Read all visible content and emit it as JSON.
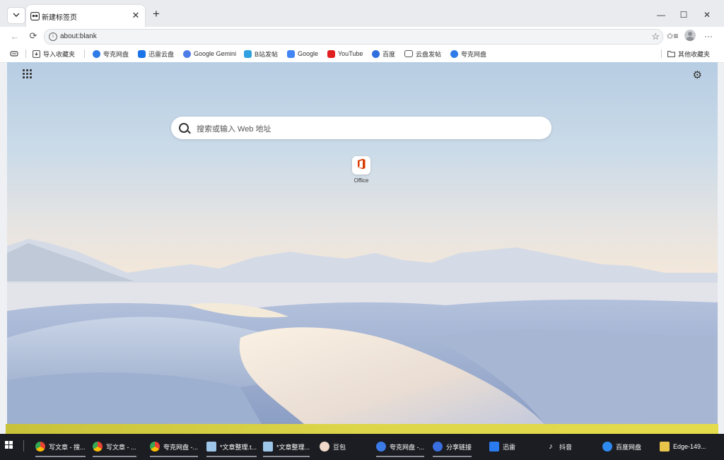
{
  "browser": {
    "tab": {
      "title": "新建标签页",
      "close_glyph": "✕"
    },
    "new_tab_glyph": "+",
    "window": {
      "minimize": "—",
      "maximize": "☐",
      "close": "✕"
    },
    "address": {
      "value": "about:blank",
      "info_glyph": "i",
      "star_glyph": "☆"
    },
    "nav": {
      "back": "←",
      "refresh": "⟳",
      "favorites": "✩≡",
      "more": "···"
    }
  },
  "bookmarks": {
    "import": "导入收藏夹",
    "items": [
      {
        "label": "夸克网盘",
        "icon": "cloud-icon",
        "color": "#2f7be8"
      },
      {
        "label": "迅雷云盘",
        "icon": "xunlei-icon",
        "color": "#1a73e8"
      },
      {
        "label": "Google Gemini",
        "icon": "gemini-icon",
        "color": "#4f7de8"
      },
      {
        "label": "B站发帖",
        "icon": "bilibili-icon",
        "color": "#2fa0e0"
      },
      {
        "label": "Google",
        "icon": "google-icon",
        "color": "#4285f4"
      },
      {
        "label": "YouTube",
        "icon": "youtube-icon",
        "color": "#e02020"
      },
      {
        "label": "百度",
        "icon": "baidu-icon",
        "color": "#2f6fde"
      },
      {
        "label": "云盘发帖",
        "icon": "folder-icon",
        "color": "#555555"
      },
      {
        "label": "夸克网盘",
        "icon": "cloud-icon",
        "color": "#2f7be8"
      }
    ],
    "other": "其他收藏夹"
  },
  "newtab": {
    "search_placeholder": "搜索或输入 Web 地址",
    "tiles": [
      {
        "label": "Office",
        "icon": "office-icon"
      }
    ],
    "settings_glyph": "⚙"
  },
  "taskbar": {
    "items": [
      {
        "label": "写文章 - 搜...",
        "icon": "chrome-icon"
      },
      {
        "label": "写文章 - ...",
        "icon": "chrome-icon"
      },
      {
        "label": "夸克网盘 -...",
        "icon": "chrome-icon"
      },
      {
        "label": "*文章整理.t...",
        "icon": "notepad-icon"
      },
      {
        "label": "*文章整理...",
        "icon": "notepad-icon"
      },
      {
        "label": "豆包",
        "icon": "doubao-icon"
      },
      {
        "label": "夸克网盘 -...",
        "icon": "quark-icon"
      },
      {
        "label": "分享链接",
        "icon": "share-icon"
      },
      {
        "label": "迅雷",
        "icon": "xunlei-icon"
      },
      {
        "label": "抖音",
        "icon": "douyin-icon"
      },
      {
        "label": "百度网盘",
        "icon": "baidupan-icon"
      },
      {
        "label": "Edge-149...",
        "icon": "file-icon"
      }
    ]
  },
  "colors": {
    "accent": "#1a73e8",
    "taskbar_bg": "#1b1d22",
    "strip": "#ddd64a"
  }
}
